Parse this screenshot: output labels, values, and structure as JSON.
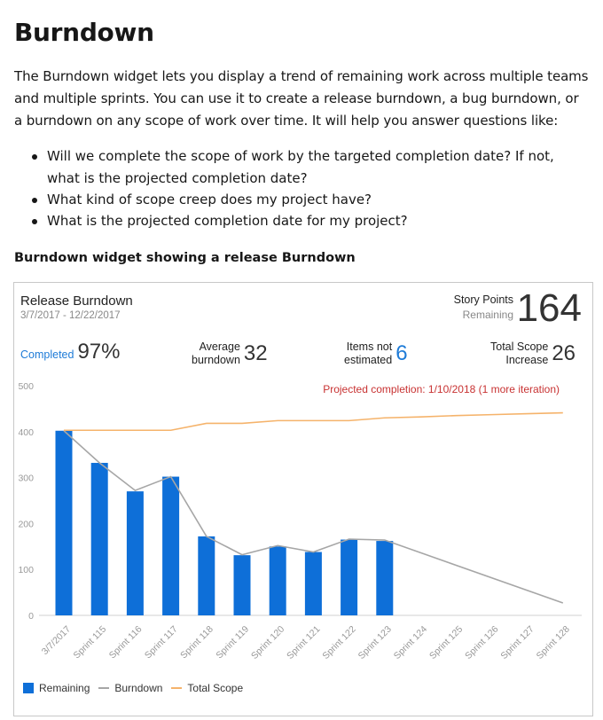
{
  "doc": {
    "heading": "Burndown",
    "intro": "The Burndown widget lets you display a trend of remaining work across multiple teams and multiple sprints. You can use it to create a release burndown, a bug burndown, or a burndown on any scope of work over time. It will help you answer questions like:",
    "bullets": [
      "Will we complete the scope of work by the targeted completion date? If not, what is the projected completion date?",
      "What kind of scope creep does my project have?",
      "What is the projected completion date for my project?"
    ],
    "caption": "Burndown widget showing a release Burndown"
  },
  "widget": {
    "title": "Release Burndown",
    "date_range": "3/7/2017 - 12/22/2017",
    "story_points_label": "Story Points",
    "story_points_sub": "Remaining",
    "story_points_value": "164",
    "completed_label": "Completed",
    "completed_value": "97%",
    "avg_label_1": "Average",
    "avg_label_2": "burndown",
    "avg_value": "32",
    "items_label_1": "Items not",
    "items_label_2": "estimated",
    "items_value": "6",
    "scope_label_1": "Total Scope",
    "scope_label_2": "Increase",
    "scope_value": "26",
    "projection": "Projected completion: 1/10/2018 (1 more iteration)",
    "legend": {
      "remaining": "Remaining",
      "burndown": "Burndown",
      "total_scope": "Total Scope"
    },
    "colors": {
      "remaining": "#0e6fd8",
      "burndown": "#a6a6a6",
      "total_scope": "#f5b36b",
      "projection": "#c83232",
      "accent": "#1e7bd7"
    }
  },
  "chart_data": {
    "type": "bar",
    "categories": [
      "3/7/2017",
      "Sprint 115",
      "Sprint 116",
      "Sprint 117",
      "Sprint 118",
      "Sprint 119",
      "Sprint 120",
      "Sprint 121",
      "Sprint 122",
      "Sprint 123",
      "Sprint 124",
      "Sprint 125",
      "Sprint 126",
      "Sprint 127",
      "Sprint 128"
    ],
    "series": [
      {
        "name": "Remaining",
        "kind": "bar",
        "values": [
          402,
          332,
          270,
          302,
          172,
          131,
          150,
          138,
          165,
          162,
          null,
          null,
          null,
          null,
          null
        ]
      },
      {
        "name": "Burndown",
        "kind": "line",
        "values": [
          402,
          332,
          272,
          302,
          172,
          132,
          152,
          138,
          166,
          164,
          null,
          null,
          null,
          null,
          27
        ]
      },
      {
        "name": "Total Scope",
        "kind": "line",
        "values": [
          403,
          403,
          403,
          403,
          418,
          418,
          424,
          424,
          424,
          430,
          432,
          435,
          437,
          439,
          441
        ]
      }
    ],
    "yticks": [
      0,
      100,
      200,
      300,
      400,
      500
    ],
    "ylim": [
      0,
      500
    ],
    "grid": false,
    "legend_position": "bottom-left"
  }
}
